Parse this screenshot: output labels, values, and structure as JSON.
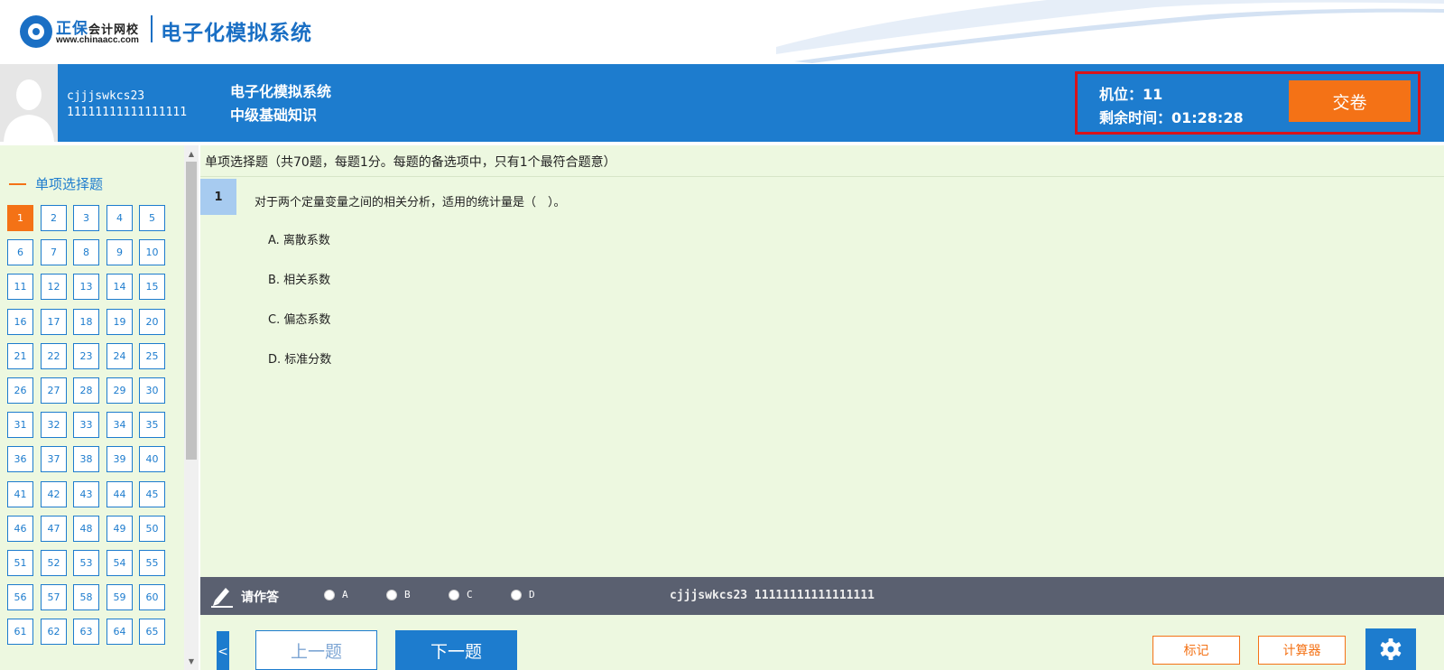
{
  "logo": {
    "brand_main": "正保",
    "brand_sub": "会计网校",
    "url": "www.chinaacc.com",
    "system_name": "电子化模拟系统",
    "icon": "chinaacc-logo-icon"
  },
  "header": {
    "user_name": "cjjjswkcs23",
    "user_id": "11111111111111111",
    "exam_title": "电子化模拟系统",
    "exam_subject": "中级基础知识",
    "seat": "机位：11",
    "timer": "剩余时间：01:28:28",
    "submit_label": "交卷"
  },
  "sidebar": {
    "section_title": "单项选择题",
    "active_question": "1",
    "question_numbers": [
      "1",
      "2",
      "3",
      "4",
      "5",
      "6",
      "7",
      "8",
      "9",
      "10",
      "11",
      "12",
      "13",
      "14",
      "15",
      "16",
      "17",
      "18",
      "19",
      "20",
      "21",
      "22",
      "23",
      "24",
      "25",
      "26",
      "27",
      "28",
      "29",
      "30",
      "31",
      "32",
      "33",
      "34",
      "35",
      "36",
      "37",
      "38",
      "39",
      "40",
      "41",
      "42",
      "43",
      "44",
      "45",
      "46",
      "47",
      "48",
      "49",
      "50",
      "51",
      "52",
      "53",
      "54",
      "55",
      "56",
      "57",
      "58",
      "59",
      "60",
      "61",
      "62",
      "63",
      "64",
      "65"
    ]
  },
  "main": {
    "instructions": "单项选择题（共70题，每题1分。每题的备选项中，只有1个最符合题意）",
    "question_number": "1",
    "question_text": "对于两个定量变量之间的相关分析，适用的统计量是（　）。",
    "options": [
      "A. 离散系数",
      "B. 相关系数",
      "C. 偏态系数",
      "D. 标准分数"
    ]
  },
  "answer_bar": {
    "label": "请作答",
    "choices": [
      "A",
      "B",
      "C",
      "D"
    ],
    "user_info": "cjjjswkcs23 11111111111111111"
  },
  "nav": {
    "prev_label": "上一题",
    "next_label": "下一题",
    "mark_label": "标记",
    "calculator_label": "计算器",
    "toggle_symbol": "<"
  },
  "colors": {
    "primary_blue": "#1d7cce",
    "accent_orange": "#f47216",
    "content_bg": "#edf8e0",
    "highlight_red": "#d9131a",
    "answer_bar_bg": "#5a6070"
  }
}
